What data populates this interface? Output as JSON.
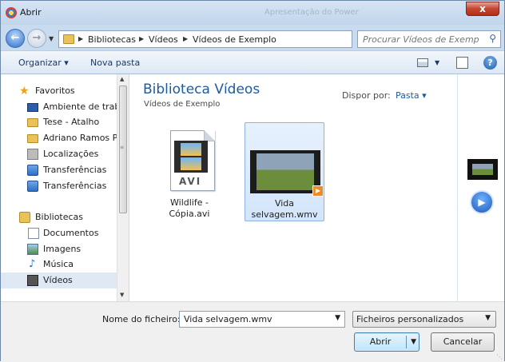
{
  "window": {
    "title": "Abrir",
    "background_title": "Apresentação do Power",
    "close_label": "x"
  },
  "address": {
    "crumbs": [
      "Bibliotecas",
      "Vídeos",
      "Vídeos de Exemplo"
    ],
    "search_placeholder": "Procurar Vídeos de Exemplo"
  },
  "toolbar": {
    "organize_label": "Organizar ▾",
    "new_folder_label": "Nova pasta"
  },
  "sidebar": {
    "favorites_header": "Favoritos",
    "favorites": [
      "Ambiente de trabalho",
      "Tese - Atalho",
      "Adriano Ramos Pi",
      "Localizações",
      "Transferências",
      "Transferências"
    ],
    "libraries_header": "Bibliotecas",
    "libraries": [
      "Documentos",
      "Imagens",
      "Música",
      "Vídeos"
    ],
    "selected": "Vídeos"
  },
  "content": {
    "library_title": "Biblioteca Vídeos",
    "library_subtitle": "Vídeos de Exemplo",
    "arrange_label": "Dispor por:",
    "arrange_value": "Pasta ▾",
    "files": [
      {
        "name_line1": "Wildlife -",
        "name_line2": "Cópia.avi",
        "type_badge": "AVI",
        "icon": "avi-file-icon"
      },
      {
        "name_line1": "Vida",
        "name_line2": "selvagem.wmv",
        "icon": "video-thumbnail-icon",
        "selected": true
      }
    ]
  },
  "bottom": {
    "filename_label": "Nome do ficheiro:",
    "filename_value": "Vida selvagem.wmv",
    "filetype_value": "Ficheiros personalizados",
    "open_label": "Abrir",
    "cancel_label": "Cancelar"
  },
  "colors": {
    "accent_blue": "#1e5aa0",
    "selection_fill": "#d3e5fb",
    "close_red": "#c4452f"
  }
}
